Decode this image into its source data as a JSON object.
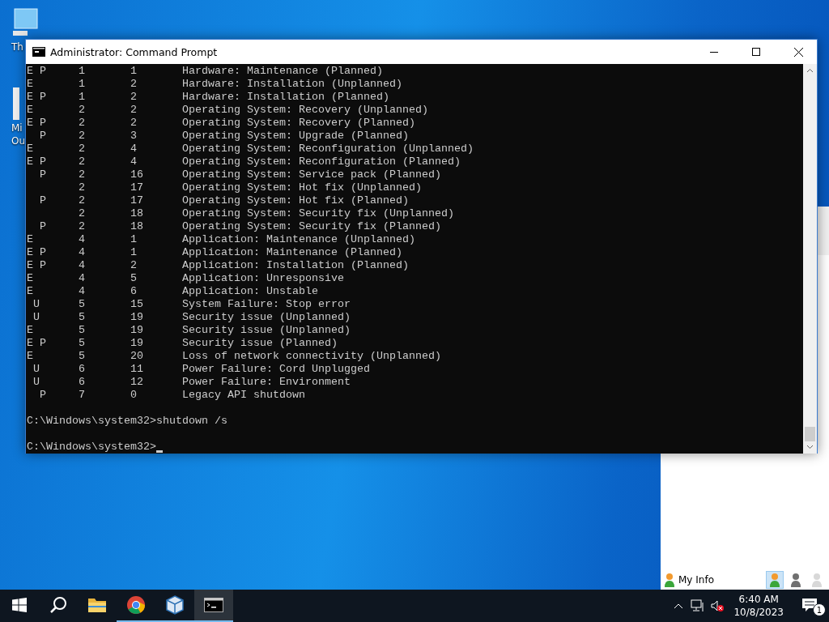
{
  "desktop_icons": [
    {
      "label": "Th"
    },
    {
      "label": "Mi Ou"
    }
  ],
  "window": {
    "title": "Administrator: Command Prompt"
  },
  "output_lines": [
    "E P     1       1       Hardware: Maintenance (Planned)",
    "E       1       2       Hardware: Installation (Unplanned)",
    "E P     1       2       Hardware: Installation (Planned)",
    "E       2       2       Operating System: Recovery (Unplanned)",
    "E P     2       2       Operating System: Recovery (Planned)",
    "  P     2       3       Operating System: Upgrade (Planned)",
    "E       2       4       Operating System: Reconfiguration (Unplanned)",
    "E P     2       4       Operating System: Reconfiguration (Planned)",
    "  P     2       16      Operating System: Service pack (Planned)",
    "        2       17      Operating System: Hot fix (Unplanned)",
    "  P     2       17      Operating System: Hot fix (Planned)",
    "        2       18      Operating System: Security fix (Unplanned)",
    "  P     2       18      Operating System: Security fix (Planned)",
    "E       4       1       Application: Maintenance (Unplanned)",
    "E P     4       1       Application: Maintenance (Planned)",
    "E P     4       2       Application: Installation (Planned)",
    "E       4       5       Application: Unresponsive",
    "E       4       6       Application: Unstable",
    " U      5       15      System Failure: Stop error",
    " U      5       19      Security issue (Unplanned)",
    "E       5       19      Security issue (Unplanned)",
    "E P     5       19      Security issue (Planned)",
    "E       5       20      Loss of network connectivity (Unplanned)",
    " U      6       11      Power Failure: Cord Unplugged",
    " U      6       12      Power Failure: Environment",
    "  P     7       0       Legacy API shutdown"
  ],
  "commands": [
    {
      "text": "C:\\Windows\\system32>shutdown /s"
    },
    {
      "text": "C:\\Windows\\system32>"
    }
  ],
  "background_window": {
    "label": "My Info",
    "status_icons": [
      {
        "kind": "online",
        "selected": true
      },
      {
        "kind": "busy",
        "selected": false
      },
      {
        "kind": "offline",
        "selected": false
      }
    ]
  },
  "taskbar": {
    "apps": [
      {
        "kind": "explorer",
        "running": false,
        "active": false
      },
      {
        "kind": "chrome",
        "running": true,
        "active": false
      },
      {
        "kind": "cube",
        "running": true,
        "active": false
      },
      {
        "kind": "terminal",
        "running": true,
        "active": true
      }
    ],
    "time": "6:40 AM",
    "date": "10/8/2023",
    "notification_count": "1"
  }
}
